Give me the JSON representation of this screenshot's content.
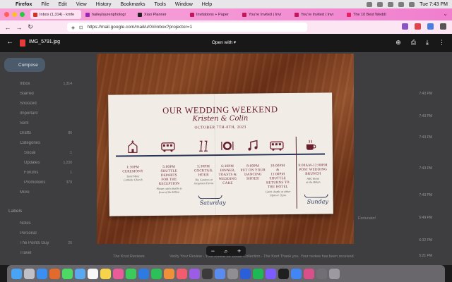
{
  "menubar": {
    "app": "Firefox",
    "items": [
      "File",
      "Edit",
      "View",
      "History",
      "Bookmarks",
      "Tools",
      "Window",
      "Help"
    ],
    "clock": "Tue 7:43 PM"
  },
  "tabs": [
    {
      "label": "Inbox (1,314) - kmfe",
      "active": true,
      "color": "#d93025"
    },
    {
      "label": "haileylaurenphotogr",
      "active": false,
      "color": "#9c27b0"
    },
    {
      "label": "Xiao Planner",
      "active": false,
      "color": "#222222"
    },
    {
      "label": "Invitations + Paper",
      "active": false,
      "color": "#c2185b"
    },
    {
      "label": "You're Invited | Invi",
      "active": false,
      "color": "#c2185b"
    },
    {
      "label": "You're Invited | Invi",
      "active": false,
      "color": "#c2185b"
    },
    {
      "label": "The 10 Best Weddi",
      "active": false,
      "color": "#e91e63"
    }
  ],
  "url": "https://mail.google.com/mail/u/0/#inbox?projector=1",
  "viewer": {
    "filename": "IMG_5791.jpg",
    "open_with": "Open with"
  },
  "gmail": {
    "compose": "Compose",
    "sidebar": [
      {
        "label": "Inbox",
        "count": "1,314"
      },
      {
        "label": "Starred",
        "count": ""
      },
      {
        "label": "Snoozed",
        "count": ""
      },
      {
        "label": "Important",
        "count": ""
      },
      {
        "label": "Sent",
        "count": ""
      },
      {
        "label": "Drafts",
        "count": "86"
      },
      {
        "label": "Categories",
        "count": ""
      },
      {
        "label": "Social",
        "count": "1"
      },
      {
        "label": "Updates",
        "count": "1,230"
      },
      {
        "label": "Forums",
        "count": "1"
      },
      {
        "label": "Promotions",
        "count": "379"
      },
      {
        "label": "More",
        "count": ""
      }
    ],
    "labels_heading": "Labels",
    "labels": [
      {
        "label": "Notes",
        "count": ""
      },
      {
        "label": "Personal",
        "count": ""
      },
      {
        "label": "The Points Guy",
        "count": "26"
      },
      {
        "label": "Travel",
        "count": ""
      }
    ],
    "times": [
      "7:43 PM",
      "7:43 PM",
      "7:43 PM",
      "7:43 PM",
      "7:43 PM",
      "6:49 PM",
      "6:32 PM",
      "5:21 PM"
    ],
    "snippets": [
      {
        "sender": "The Knot Reviews",
        "text": "Verify Your Review - Your review for Bridal Collection - The Knot Thank you. Your review has been received."
      },
      {
        "sender": "Fortunato!",
        "text": "You'll...Order Confirmation..."
      }
    ]
  },
  "card": {
    "title": "OUR WEDDING WEEKEND",
    "names": "Kristen & Colin",
    "date": "OCTOBER 7TH-8TH, 2023",
    "events": [
      {
        "time": "1:30PM",
        "desc": [
          "CEREMONY"
        ],
        "note": [
          "Saint Mary",
          "Catholic Church"
        ]
      },
      {
        "time": "5:00PM",
        "desc": [
          "SHUTTLE DEPARTS",
          "FOR THE",
          "RECEPTION"
        ],
        "note": [
          "Please catch shuttle in",
          "front of the Hilton"
        ]
      },
      {
        "time": "5:30PM",
        "desc": [
          "COCKTAIL",
          "HOUR"
        ],
        "note": [
          "The Gardens at",
          "Jorgensen Farms"
        ]
      },
      {
        "time": "6:30PM",
        "desc": [
          "DINNER,",
          "TOASTS &",
          "WEDDING",
          "CAKE"
        ],
        "note": []
      },
      {
        "time": "8:00PM",
        "desc": [
          "PUT ON YOUR",
          "DANCING",
          "SHOES!"
        ],
        "note": []
      },
      {
        "time": "10:00PM",
        "desc": [
          "&",
          "11:00PM",
          "SHUTTLE",
          "RETURNS TO",
          "THE HOTEL"
        ],
        "note": [
          "Catch shuttle at either",
          "10pm or 11pm."
        ]
      },
      {
        "time": "9:00AM-12:00PM",
        "desc": [
          "POST WEDDING",
          "BRUNCH"
        ],
        "note": [
          "ABC Room",
          "at the Hilton"
        ]
      }
    ],
    "day1": "Saturday",
    "day2": "Sunday"
  },
  "zoom": {
    "minus": "−",
    "plus": "+"
  }
}
